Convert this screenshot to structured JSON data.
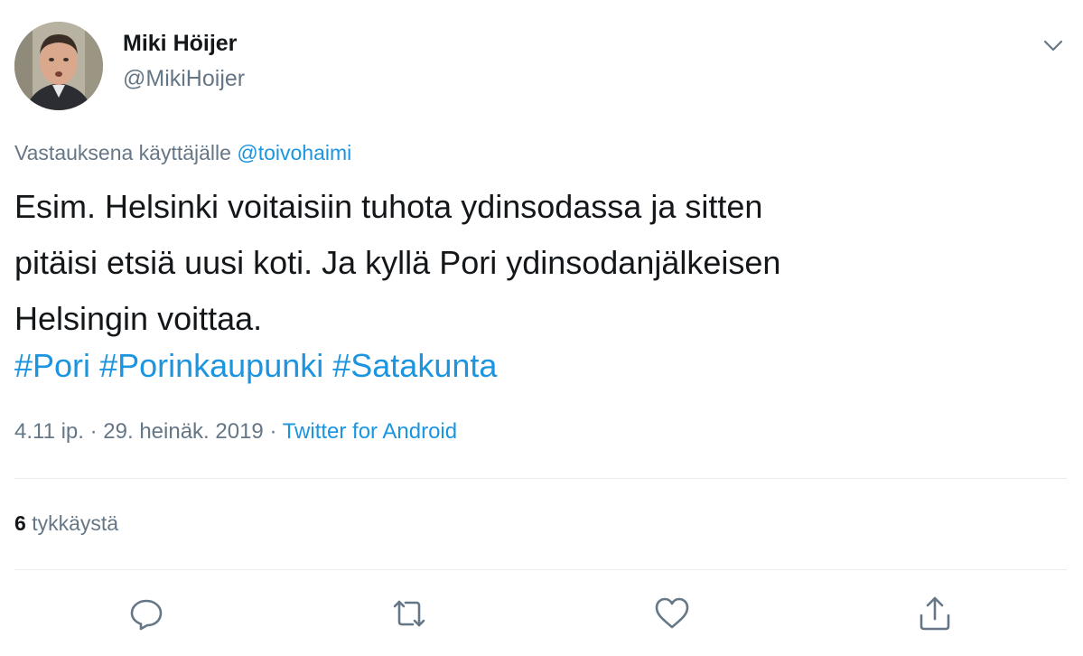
{
  "author": {
    "display_name": "Miki Höijer",
    "handle": "@MikiHoijer"
  },
  "reply_context": {
    "prefix": "Vastauksena käyttäjälle",
    "mention": "@toivohaimi"
  },
  "tweet": {
    "lines": [
      "Esim. Helsinki voitaisiin tuhota ydinsodassa ja sitten",
      "pitäisi etsiä uusi koti. Ja kyllä Pori ydinsodanjälkeisen",
      "Helsingin voittaa."
    ],
    "hashtags": [
      "#Pori",
      "#Porinkaupunki",
      "#Satakunta"
    ]
  },
  "meta": {
    "time": "4.11 ip.",
    "separator": "·",
    "date": "29. heinäk. 2019",
    "source": "Twitter for Android"
  },
  "stats": {
    "likes_count": "6",
    "likes_label": "tykkäystä"
  },
  "actions": {
    "icons": [
      "reply-icon",
      "retweet-icon",
      "like-icon",
      "share-icon"
    ]
  },
  "colors": {
    "link": "#1b95e0",
    "secondary_text": "#657786",
    "primary_text": "#14171a",
    "divider": "#e6ecf0"
  }
}
